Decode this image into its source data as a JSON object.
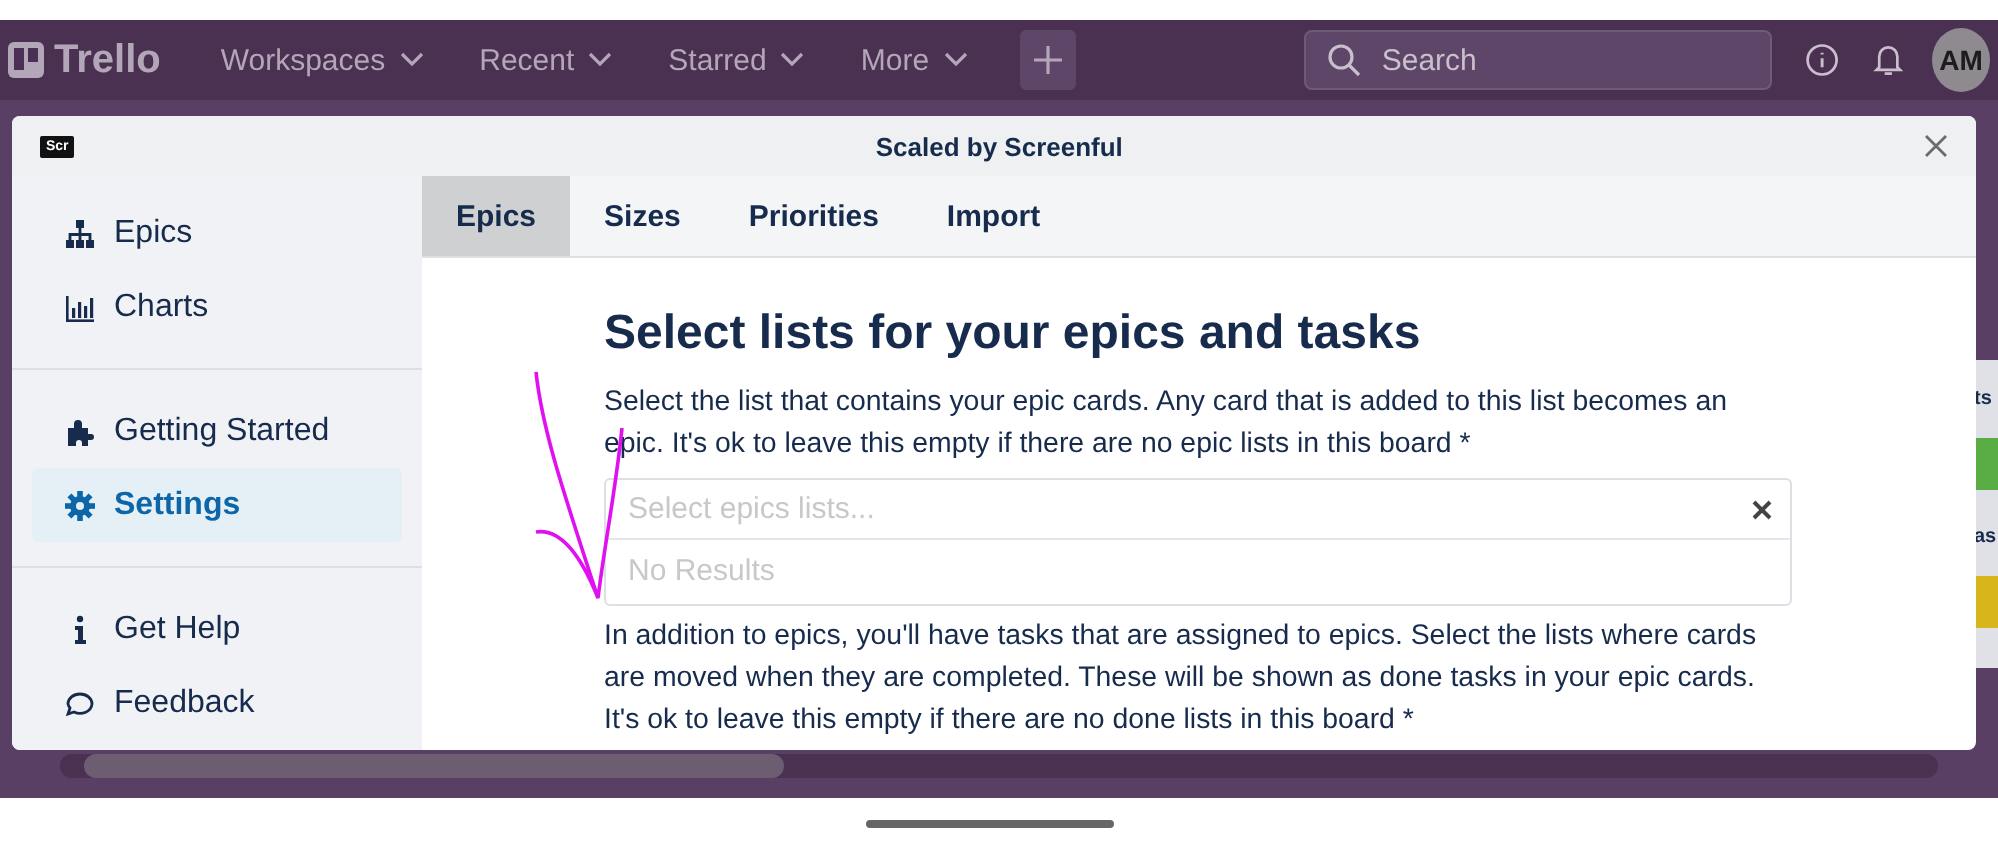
{
  "topbar": {
    "logo": "Trello",
    "menus": [
      {
        "label": "Workspaces"
      },
      {
        "label": "Recent"
      },
      {
        "label": "Starred"
      },
      {
        "label": "More"
      }
    ],
    "search": {
      "placeholder": "Search"
    },
    "avatar": "AM"
  },
  "board_fragments": [
    {
      "text": "ts",
      "color": "#5aac44"
    },
    {
      "text": "as",
      "color": "#d9b51c"
    }
  ],
  "modal": {
    "logo": "Scr",
    "title": "Scaled by Screenful",
    "sidebar": [
      [
        {
          "label": "Epics",
          "selected": false
        },
        {
          "label": "Charts",
          "selected": false
        }
      ],
      [
        {
          "label": "Getting Started",
          "selected": false
        },
        {
          "label": "Settings",
          "selected": true
        }
      ],
      [
        {
          "label": "Get Help",
          "selected": false
        },
        {
          "label": "Feedback",
          "selected": false
        }
      ]
    ],
    "tabs": [
      {
        "label": "Epics",
        "selected": true
      },
      {
        "label": "Sizes",
        "selected": false
      },
      {
        "label": "Priorities",
        "selected": false
      },
      {
        "label": "Import",
        "selected": false
      }
    ],
    "heading": "Select lists for your epics and tasks",
    "intro": "Select the list that contains your epic cards. Any card that is added to this list becomes an epic. It's ok to leave this empty if there are no epic lists in this board *",
    "select": {
      "placeholder": "Select epics lists...",
      "dropdown": "No Results"
    },
    "second": "In addition to epics, you'll have tasks that are assigned to epics. Select the lists where cards are moved when they are completed. These will be shown as done tasks in your epic cards. It's ok to leave this empty if there are no done lists in this board *"
  }
}
